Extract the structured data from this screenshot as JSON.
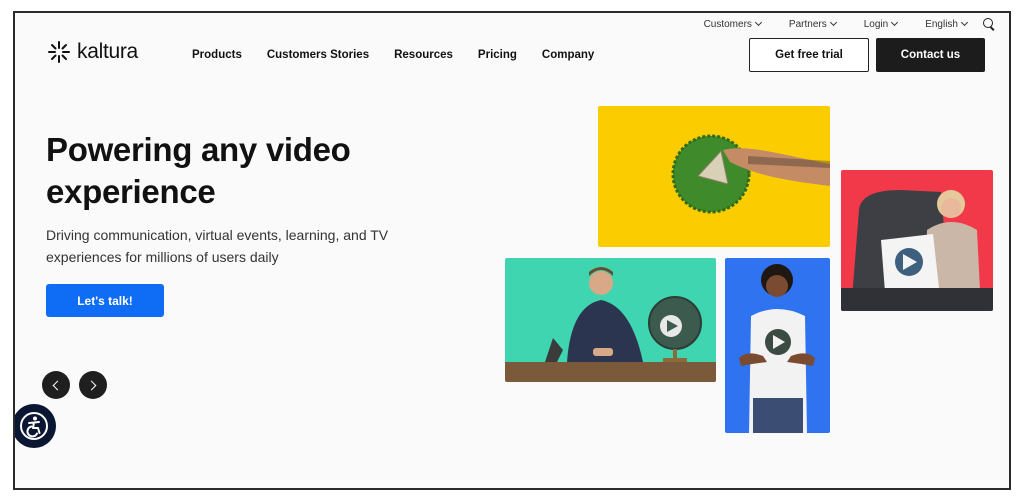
{
  "utility_nav": {
    "items": [
      {
        "label": "Customers",
        "has_dropdown": true
      },
      {
        "label": "Partners",
        "has_dropdown": true
      },
      {
        "label": "Login",
        "has_dropdown": true
      },
      {
        "label": "English",
        "has_dropdown": true
      }
    ],
    "search_icon": "search-icon"
  },
  "brand": {
    "name": "kaltura",
    "logo_icon": "kaltura-asterisk-logo"
  },
  "main_nav": {
    "items": [
      "Products",
      "Customers Stories",
      "Resources",
      "Pricing",
      "Company"
    ]
  },
  "header_actions": {
    "trial_label": "Get free trial",
    "contact_label": "Contact us"
  },
  "hero": {
    "title_line1": "Powering any video",
    "title_line2": "experience",
    "subtitle_line1": "Driving communication, virtual events, learning, and TV",
    "subtitle_line2": "experiences for millions of users daily",
    "cta_label": "Let's talk!"
  },
  "carousel": {
    "prev_icon": "chevron-left-icon",
    "next_icon": "chevron-right-icon"
  },
  "accessibility": {
    "icon": "accessibility-icon"
  },
  "colors": {
    "cta_blue": "#0e6cf5",
    "dark_button": "#1c1c1c",
    "tile_yellow": "#fbcc00",
    "tile_green": "#3fd5b0",
    "tile_blue": "#2f73f0",
    "tile_red": "#f1394a"
  }
}
